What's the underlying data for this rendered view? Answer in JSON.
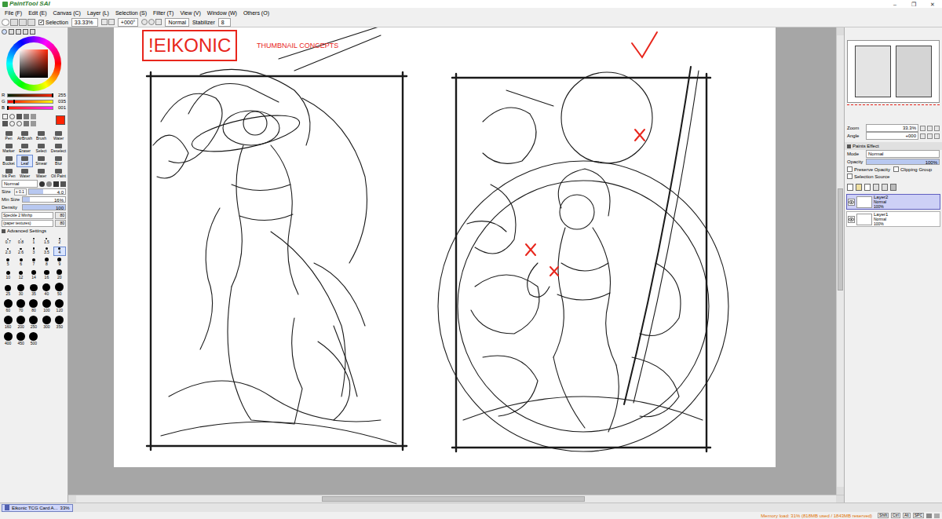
{
  "app": {
    "logo": "PaintTool SAI"
  },
  "window_controls": [
    "–",
    "❐",
    "✕"
  ],
  "menu": [
    "File (F)",
    "Edit (E)",
    "Canvas (C)",
    "Layer (L)",
    "Selection (S)",
    "Filter (T)",
    "View (V)",
    "Window (W)",
    "Others (O)"
  ],
  "toolbar": {
    "selection": {
      "label": "Selection",
      "checked": true
    },
    "zoom": "33.33%",
    "angle": "+000°",
    "blend": "Normal",
    "stabilizer_label": "Stabilizer",
    "stabilizer": "8"
  },
  "color": {
    "current": "#ff2301",
    "sliders": [
      {
        "label": "R",
        "value": "255",
        "level": 1
      },
      {
        "label": "G",
        "value": "035",
        "level": 0.137
      },
      {
        "label": "B",
        "value": "001",
        "level": 0.004
      }
    ]
  },
  "tools": [
    {
      "label": "Pen",
      "selected": false
    },
    {
      "label": "AirBrush",
      "selected": false
    },
    {
      "label": "Brush",
      "selected": false
    },
    {
      "label": "Water",
      "selected": false
    },
    {
      "label": "Marker",
      "selected": false
    },
    {
      "label": "Eraser",
      "selected": false
    },
    {
      "label": "Select",
      "selected": false
    },
    {
      "label": "Deselect",
      "selected": false
    },
    {
      "label": "Bucket",
      "selected": false
    },
    {
      "label": "Leaf",
      "selected": true
    },
    {
      "label": "Smear",
      "selected": false
    },
    {
      "label": "Blur",
      "selected": false
    },
    {
      "label": "Ink Pen",
      "selected": false
    },
    {
      "label": "Water",
      "selected": false
    },
    {
      "label": "Water",
      "selected": false
    },
    {
      "label": "Oil Paint",
      "selected": false
    }
  ],
  "brush": {
    "mode": "Normal",
    "size_label": "Size",
    "size_mult": "x 0.1",
    "size": "4.0",
    "size_level": 0.4,
    "min_size_label": "Min Size",
    "min_size": "16%",
    "min_size_level": 0.16,
    "density_label": "Density",
    "density": "100",
    "density_level": 1,
    "shape": "Speckle 2 Minhp",
    "shape_strength": "80",
    "texture": "(paper textures)",
    "texture_strength": "80",
    "advanced": "Advanced Settings"
  },
  "brush_sizes": [
    {
      "label": "0.7",
      "selected": false
    },
    {
      "label": "0.8",
      "selected": false
    },
    {
      "label": "1",
      "selected": false
    },
    {
      "label": "1.5",
      "selected": false
    },
    {
      "label": "2",
      "selected": false
    },
    {
      "label": "2.3",
      "selected": false
    },
    {
      "label": "2.6",
      "selected": false
    },
    {
      "label": "3",
      "selected": false
    },
    {
      "label": "3.5",
      "selected": false
    },
    {
      "label": "4",
      "selected": true
    },
    {
      "label": "5",
      "selected": false
    },
    {
      "label": "6",
      "selected": false
    },
    {
      "label": "7",
      "selected": false
    },
    {
      "label": "8",
      "selected": false
    },
    {
      "label": "9",
      "selected": false
    },
    {
      "label": "10",
      "selected": false
    },
    {
      "label": "12",
      "selected": false
    },
    {
      "label": "14",
      "selected": false
    },
    {
      "label": "16",
      "selected": false
    },
    {
      "label": "20",
      "selected": false
    },
    {
      "label": "25",
      "selected": false
    },
    {
      "label": "30",
      "selected": false
    },
    {
      "label": "35",
      "selected": false
    },
    {
      "label": "40",
      "selected": false
    },
    {
      "label": "50",
      "selected": false
    },
    {
      "label": "60",
      "selected": false
    },
    {
      "label": "70",
      "selected": false
    },
    {
      "label": "80",
      "selected": false
    },
    {
      "label": "100",
      "selected": false
    },
    {
      "label": "120",
      "selected": false
    },
    {
      "label": "160",
      "selected": false
    },
    {
      "label": "200",
      "selected": false
    },
    {
      "label": "250",
      "selected": false
    },
    {
      "label": "300",
      "selected": false
    },
    {
      "label": "350",
      "selected": false
    },
    {
      "label": "400",
      "selected": false
    },
    {
      "label": "450",
      "selected": false
    },
    {
      "label": "500",
      "selected": false
    }
  ],
  "canvas": {
    "title": "!EIKONIC",
    "subtitle": "THUMBNAIL CONCEPTS"
  },
  "navigator": {
    "zoom_label": "Zoom",
    "zoom": "33.3%",
    "angle_label": "Angle",
    "angle": "+000"
  },
  "layer_panel": {
    "title": "Paints Effect",
    "mode_label": "Mode",
    "mode": "Normal",
    "opacity_label": "Opacity",
    "opacity": "100%",
    "opacity_level": 1,
    "options": [
      {
        "label": "Preserve Opacity",
        "checked": false
      },
      {
        "label": "Clipping Group",
        "checked": false
      },
      {
        "label": "Selection Source",
        "checked": false
      }
    ]
  },
  "layers": [
    {
      "name": "Layer2",
      "mode": "Normal",
      "opacity": "100%",
      "visible": true,
      "selected": true
    },
    {
      "name": "Layer1",
      "mode": "Normal",
      "opacity": "100%",
      "visible": true,
      "selected": false
    }
  ],
  "documents": [
    {
      "title": "Eikonic TCG Card A...",
      "zoom": "33%",
      "selected": true
    }
  ],
  "status": {
    "memory": "Memory load: 31% (818MB used / 1843MB reserved)",
    "keys": [
      {
        "label": "Shift",
        "on": false
      },
      {
        "label": "Ctrl",
        "on": false
      },
      {
        "label": "Alt",
        "on": false
      },
      {
        "label": "SPC",
        "on": false
      }
    ]
  }
}
